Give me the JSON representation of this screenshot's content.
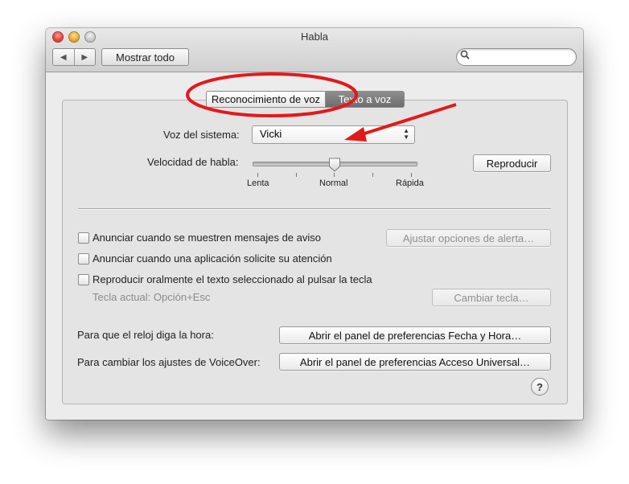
{
  "window": {
    "title": "Habla"
  },
  "toolbar": {
    "back_glyph": "◀",
    "forward_glyph": "▶",
    "show_all_label": "Mostrar todo",
    "search_placeholder": "",
    "search_value": ""
  },
  "tabs": [
    {
      "label": "Reconocimiento de voz",
      "selected": true
    },
    {
      "label": "Texto a voz",
      "selected": false
    }
  ],
  "voice": {
    "label": "Voz del sistema:",
    "selected": "Vicki",
    "arrows": {
      "up": "▲",
      "down": "▼"
    }
  },
  "speed": {
    "label": "Velocidad de habla:",
    "value_fraction": 0.5,
    "ticks": [
      "Lenta",
      "Normal",
      "Rápida"
    ],
    "play_label": "Reproducir"
  },
  "options": [
    {
      "label": "Anunciar cuando se muestren mensajes de aviso",
      "checked": false
    },
    {
      "label": "Anunciar cuando una aplicación solicite su atención",
      "checked": false
    },
    {
      "label": "Reproducir oralmente el texto seleccionado al pulsar la tecla",
      "checked": false
    }
  ],
  "alert_options_label": "Ajustar opciones de alerta…",
  "current_key_label": "Tecla actual: Opción+Esc",
  "change_key_label": "Cambiar tecla…",
  "clock": {
    "label": "Para que el reloj diga la hora:",
    "button": "Abrir el panel de preferencias Fecha y Hora…"
  },
  "voiceover": {
    "label": "Para cambiar los ajustes de VoiceOver:",
    "button": "Abrir el panel de preferencias Acceso Universal…"
  },
  "help_glyph": "?",
  "annotation_color": "#e3191b"
}
